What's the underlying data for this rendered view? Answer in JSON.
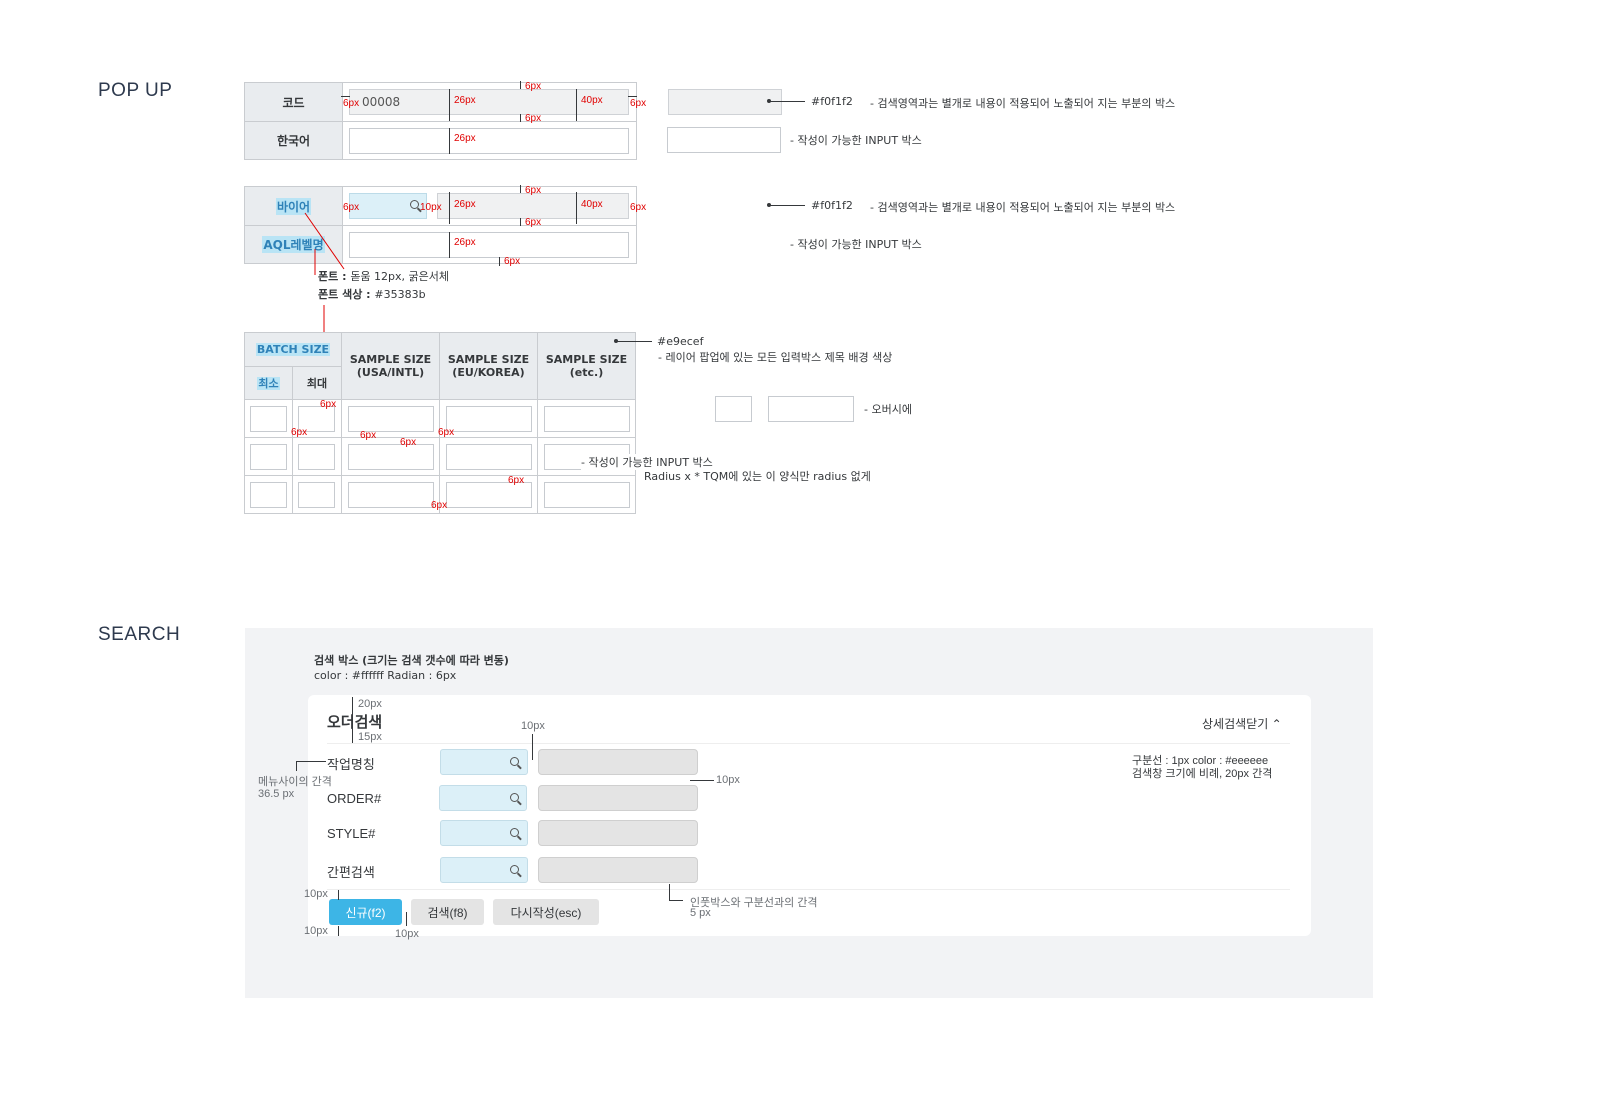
{
  "sections": {
    "popup_title": "POP UP",
    "search_title": "SEARCH"
  },
  "popup1": {
    "row1_label": "코드",
    "row1_value": "00008",
    "row2_label": "한국어"
  },
  "popup2": {
    "row1_label": "바이어",
    "row2_label": "AQL레벨명"
  },
  "dims": {
    "d6": "6px",
    "d26": "26px",
    "d40": "40px",
    "d10": "10px"
  },
  "notes": {
    "color_f0f1f2": "#f0f1f2",
    "readonly_desc": "- 검색영역과는 별개로 내용이 적용되어 노출되어 지는 부분의 박스",
    "input_desc": "- 작성이 가능한 INPUT 박스",
    "font_label": "폰트 : ",
    "font_value": "돋움 12px, 굵은서체",
    "color_label": "폰트 색상 : ",
    "color_value": "#35383b",
    "color_e9ecef": "#e9ecef",
    "title_bg_desc": "- 레이어 팝업에 있는 모든 입력박스 제목 배경 색상",
    "hover_desc": "- 오버시에",
    "input_desc2": "- 작성이 가능한 INPUT 박스",
    "radius_desc": "Radius  x   * TQM에 있는 이 양식만 radius 없게"
  },
  "batch": {
    "batch_size": "BATCH SIZE",
    "min": "최소",
    "max": "최대",
    "usa_line1": "SAMPLE SIZE",
    "usa_line2": "(USA/INTL)",
    "eu_line1": "SAMPLE SIZE",
    "eu_line2": "(EU/KOREA)",
    "etc_line1": "SAMPLE SIZE",
    "etc_line2": "(etc.)"
  },
  "search": {
    "box_title": "검색 박스 (크기는 검색 갯수에 따라 변동)",
    "box_spec": "color : #ffffff   Radian : 6px",
    "d20": "20px",
    "d15": "15px",
    "d10": "10px",
    "heading": "오더검색",
    "toggle": "상세검색닫기",
    "divider_note1": "구분선 : 1px  color : #eeeeee",
    "divider_note2": "검색창 크기에 비례, 20px 간격",
    "gap_note1": "메뉴사이의 간격",
    "gap_note2": "36.5 px",
    "rows": [
      "작업명칭",
      "ORDER#",
      "STYLE#",
      "간편검색"
    ],
    "input_gap_note1": "인풋박스와 구분선과의 간격",
    "input_gap_note2": "5 px",
    "buttons": {
      "new": "신규(f2)",
      "search": "검색(f8)",
      "reset": "다시작성(esc)"
    }
  }
}
